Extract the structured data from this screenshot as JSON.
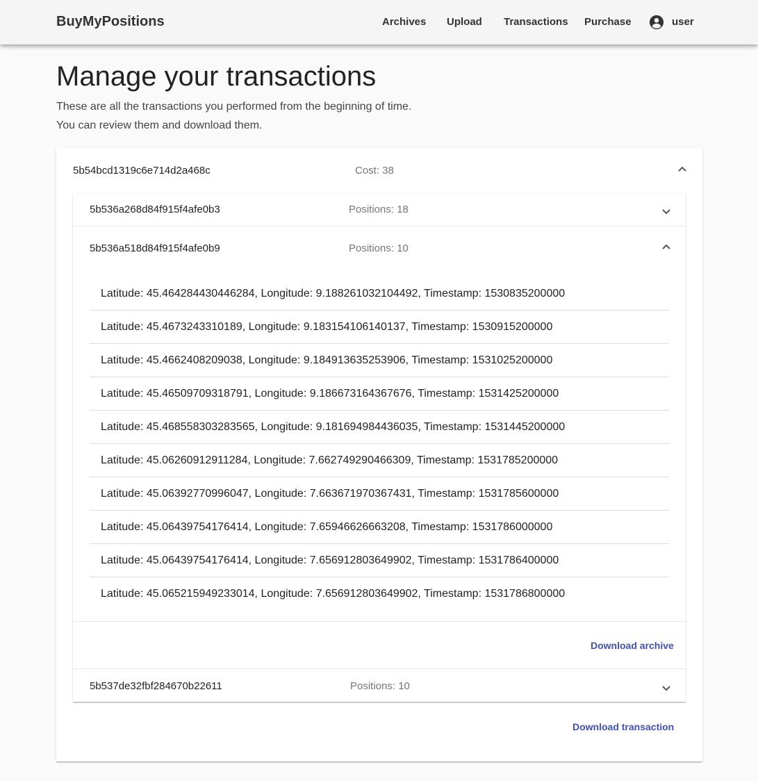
{
  "app": {
    "brand": "BuyMyPositions",
    "nav": [
      "Archives",
      "Upload",
      "Transactions",
      "Purchase"
    ],
    "user": "user"
  },
  "page": {
    "title": "Manage your transactions",
    "intro_line1": "These are all the transactions you performed from the beginning of time.",
    "intro_line2": "You can review them and download them."
  },
  "transaction": {
    "id": "5b54bcd1319c6e714d2a468c",
    "cost_label": "Cost: 38",
    "expanded": true,
    "download_label": "Download transaction",
    "archives": [
      {
        "id": "5b536a268d84f915f4afe0b3",
        "positions_label": "Positions: 18",
        "expanded": false
      },
      {
        "id": "5b536a518d84f915f4afe0b9",
        "positions_label": "Positions: 10",
        "expanded": true,
        "download_label": "Download archive",
        "positions": [
          "Latitude: 45.464284430446284,  Longitude: 9.188261032104492,  Timestamp: 1530835200000",
          "Latitude: 45.4673243310189,  Longitude: 9.183154106140137,  Timestamp: 1530915200000",
          "Latitude: 45.4662408209038,  Longitude: 9.184913635253906,  Timestamp: 1531025200000",
          "Latitude: 45.46509709318791,  Longitude: 9.186673164367676,  Timestamp: 1531425200000",
          "Latitude: 45.468558303283565,  Longitude: 9.181694984436035,  Timestamp: 1531445200000",
          "Latitude: 45.06260912911284,  Longitude: 7.662749290466309,  Timestamp: 1531785200000",
          "Latitude: 45.06392770996047,  Longitude: 7.663671970367431,  Timestamp: 1531785600000",
          "Latitude: 45.06439754176414,  Longitude: 7.65946626663208,  Timestamp: 1531786000000",
          "Latitude: 45.06439754176414,  Longitude: 7.656912803649902,  Timestamp: 1531786400000",
          "Latitude: 45.065215949233014,  Longitude: 7.656912803649902,  Timestamp: 1531786800000"
        ]
      },
      {
        "id": "5b537de32fbf284670b22611",
        "positions_label": "Positions: 10",
        "expanded": false
      }
    ]
  },
  "icons": {
    "user": "account-circle-icon",
    "expand": "chevron-down-icon",
    "collapse": "chevron-up-icon"
  },
  "colors": {
    "accent": "#3f51b5",
    "toolbar": "#f5f5f5"
  }
}
